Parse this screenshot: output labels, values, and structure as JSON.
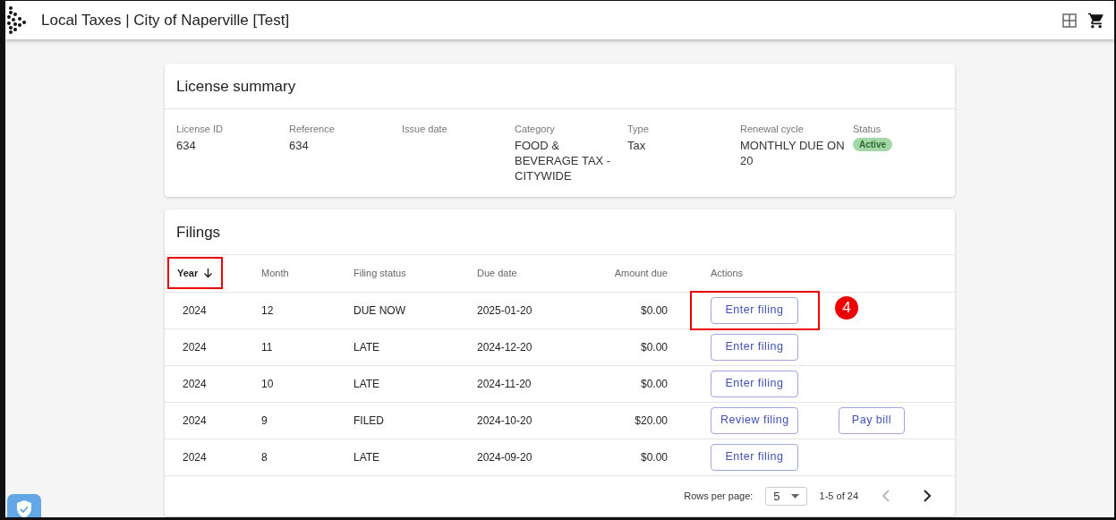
{
  "header": {
    "title": "Local Taxes | City of Naperville [Test]"
  },
  "license_summary": {
    "title": "License summary",
    "fields": [
      {
        "label": "License ID",
        "value": "634"
      },
      {
        "label": "Reference",
        "value": "634"
      },
      {
        "label": "Issue date"
      },
      {
        "label": "Category",
        "value": "FOOD & BEVERAGE TAX - CITYWIDE"
      },
      {
        "label": "Type",
        "value": "Tax"
      },
      {
        "label": "Renewal cycle",
        "value": "MONTHLY DUE ON 20"
      },
      {
        "label": "Status",
        "status": "Active"
      }
    ]
  },
  "filings": {
    "title": "Filings",
    "columns": [
      {
        "label": "Year",
        "sorted": true,
        "highlighted": true
      },
      {
        "label": "Month",
        "sorted": false,
        "highlighted": false
      },
      {
        "label": "Filing status",
        "sorted": false,
        "highlighted": false
      },
      {
        "label": "Due date",
        "sorted": false,
        "highlighted": false
      },
      {
        "label": "Amount due",
        "sorted": false,
        "highlighted": false
      },
      {
        "label": "Actions",
        "sorted": false,
        "highlighted": false
      }
    ],
    "rows": [
      {
        "year": "2024",
        "month": "12",
        "status": "DUE NOW",
        "due": "2025-01-20",
        "amount": "$0.00",
        "actions": [
          "Enter filing"
        ],
        "highlighted": true,
        "step": "4"
      },
      {
        "year": "2024",
        "month": "11",
        "status": "LATE",
        "due": "2024-12-20",
        "amount": "$0.00",
        "actions": [
          "Enter filing"
        ],
        "highlighted": false
      },
      {
        "year": "2024",
        "month": "10",
        "status": "LATE",
        "due": "2024-11-20",
        "amount": "$0.00",
        "actions": [
          "Enter filing"
        ],
        "highlighted": false
      },
      {
        "year": "2024",
        "month": "9",
        "status": "FILED",
        "due": "2024-10-20",
        "amount": "$20.00",
        "actions": [
          "Review filing",
          "Pay bill"
        ],
        "highlighted": false
      },
      {
        "year": "2024",
        "month": "8",
        "status": "LATE",
        "due": "2024-09-20",
        "amount": "$0.00",
        "actions": [
          "Enter filing"
        ],
        "highlighted": false
      }
    ],
    "pagination": {
      "rows_label": "Rows per page:",
      "rows_value": "5",
      "range": "1-5 of 24",
      "prev_disabled": true,
      "next_disabled": false
    }
  }
}
